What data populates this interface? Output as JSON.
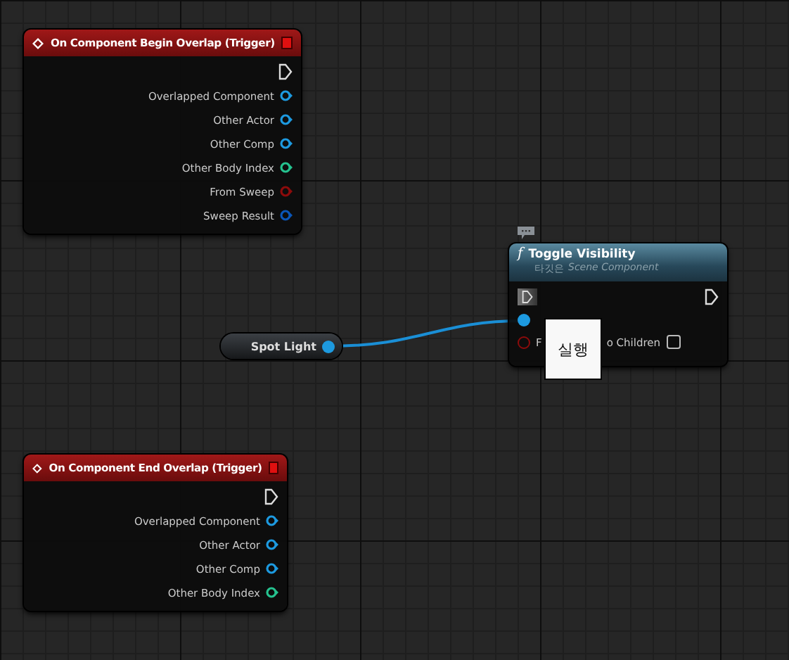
{
  "event_nodes": [
    {
      "title": "On Component Begin Overlap (Trigger)",
      "pins": [
        {
          "label": "Overlapped Component",
          "color": "#1d9ae0"
        },
        {
          "label": "Other Actor",
          "color": "#1d9ae0"
        },
        {
          "label": "Other Comp",
          "color": "#1d9ae0"
        },
        {
          "label": "Other Body Index",
          "color": "#25c28f"
        },
        {
          "label": "From Sweep",
          "color": "#8c0b0b"
        },
        {
          "label": "Sweep Result",
          "color": "#0a56b8"
        }
      ]
    },
    {
      "title": "On Component End Overlap (Trigger)",
      "pins": [
        {
          "label": "Overlapped Component",
          "color": "#1d9ae0"
        },
        {
          "label": "Other Actor",
          "color": "#1d9ae0"
        },
        {
          "label": "Other Comp",
          "color": "#1d9ae0"
        },
        {
          "label": "Other Body Index",
          "color": "#25c28f"
        }
      ]
    }
  ],
  "variable_node": {
    "label": "Spot Light"
  },
  "function_node": {
    "icon": "f",
    "title": "Toggle Visibility",
    "subtitle_prefix": "타깃은",
    "subtitle": "Scene Component",
    "pins": [
      {
        "kind": "object",
        "color": "#1d9ae0"
      },
      {
        "kind": "bool",
        "color": "#8c0b0b",
        "label_parts": [
          "F",
          "o Children"
        ],
        "checked": false
      }
    ]
  },
  "tooltip": {
    "text": "실행"
  }
}
